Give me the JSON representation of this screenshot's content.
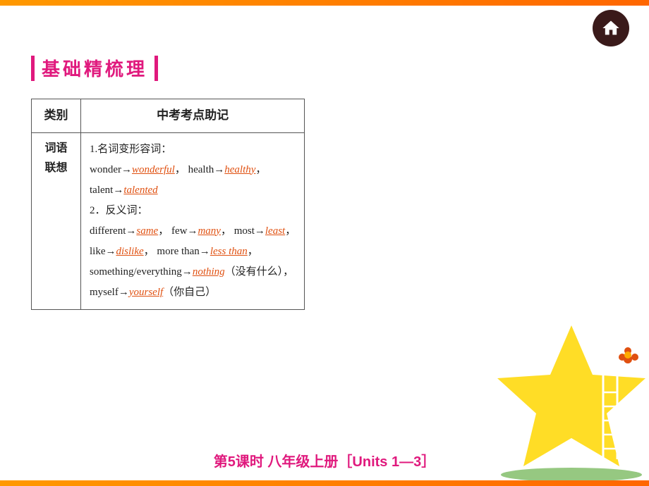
{
  "topBar": {
    "color": "#ff9900"
  },
  "homeBtn": {
    "label": "home"
  },
  "sectionTitle": {
    "text": "基础精梳理"
  },
  "table": {
    "headers": [
      "类别",
      "中考考点助记"
    ],
    "row": {
      "label": "词语\n联想",
      "content": {
        "line1": "1.名词变形容词：",
        "line2_pre": "wonder→",
        "line2_ans1": "wonderful",
        "line2_mid": "，  health→",
        "line2_ans2": "healthy",
        "line2_end": "，",
        "line3_pre": "talent→",
        "line3_ans": "talented",
        "line4": "2．反义词：",
        "line5_pre": "different→",
        "line5_ans1": "same",
        "line5_mid": "，  few→",
        "line5_ans2": "many",
        "line5_mid2": "，  most→",
        "line5_ans3": "least",
        "line5_end": "，",
        "line6_pre": "like→",
        "line6_ans1": "dislike",
        "line6_mid": "，  more than→",
        "line6_ans2": "less than",
        "line6_end": "，",
        "line7_pre": "something/everything→",
        "line7_ans": "nothing",
        "line7_end": "（没有什么），",
        "line8_pre": "myself→",
        "line8_ans": "yourself",
        "line8_end": "（你自己）"
      }
    }
  },
  "footer": {
    "text": "第5课时  八年级上册［Units 1—3］"
  }
}
